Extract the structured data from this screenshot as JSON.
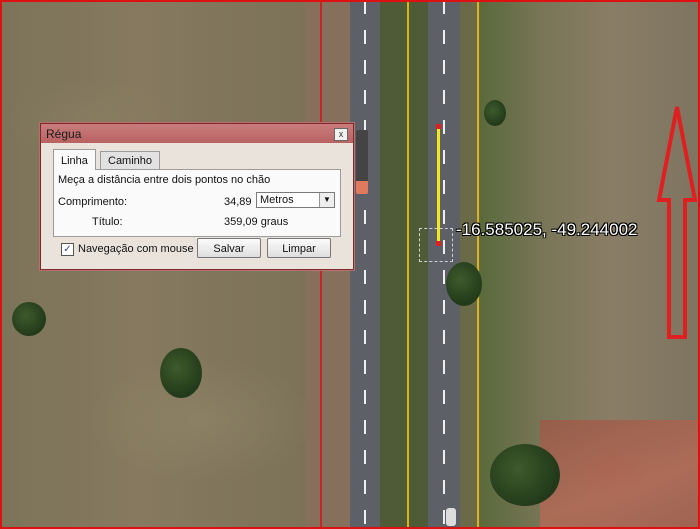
{
  "map": {
    "coordinates": "-16.585025, -49.244002",
    "north_arrow_color": "#e02020",
    "measure_line_color": "#f0e818"
  },
  "dialog": {
    "title": "Régua",
    "close_label": "x",
    "tabs": [
      {
        "label": "Linha",
        "active": true
      },
      {
        "label": "Caminho",
        "active": false
      }
    ],
    "description": "Meça a distância entre dois pontos no chão",
    "length_label": "Comprimento:",
    "length_value": "34,89",
    "unit_selected": "Metros",
    "heading_label": "Título:",
    "heading_value": "359,09 graus",
    "mouse_nav_label": "Navegação com mouse",
    "mouse_nav_checked": true,
    "save_label": "Salvar",
    "clear_label": "Limpar"
  }
}
